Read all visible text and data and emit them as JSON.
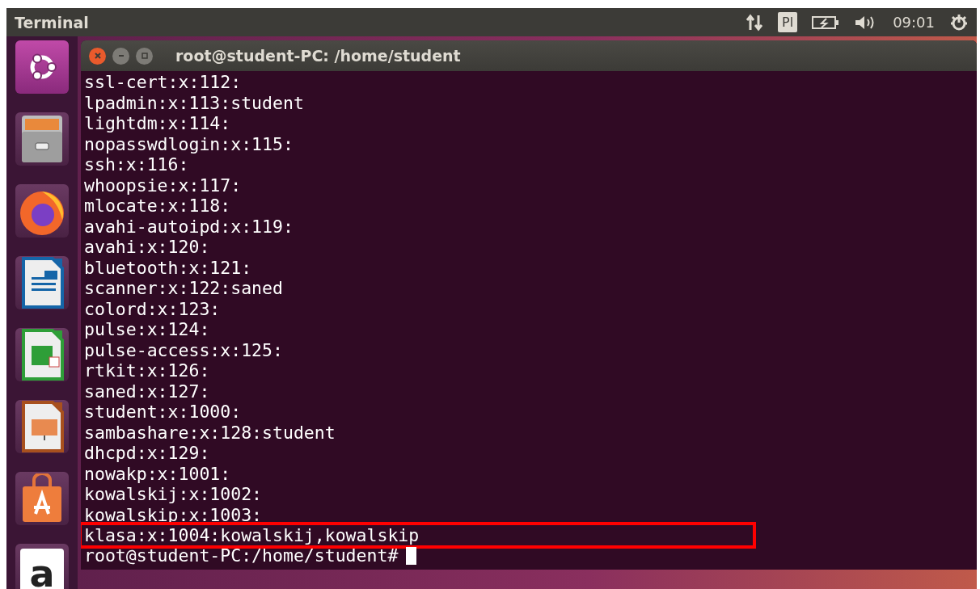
{
  "top_panel": {
    "title": "Terminal",
    "keyboard_layout": "Pl",
    "clock": "09:01"
  },
  "launcher": {
    "items": [
      {
        "kind": "dash",
        "selected": true
      },
      {
        "kind": "files",
        "selected": false
      },
      {
        "kind": "browser",
        "selected": false
      },
      {
        "kind": "writer",
        "selected": false
      },
      {
        "kind": "calc",
        "selected": false
      },
      {
        "kind": "impress",
        "selected": false
      },
      {
        "kind": "software",
        "selected": false
      },
      {
        "kind": "amazon",
        "label": "a",
        "selected": false
      }
    ]
  },
  "window": {
    "title": "root@student-PC: /home/student",
    "lines": [
      {
        "text": "ssl-cert:x:112:",
        "highlighted": false
      },
      {
        "text": "lpadmin:x:113:student",
        "highlighted": false
      },
      {
        "text": "lightdm:x:114:",
        "highlighted": false
      },
      {
        "text": "nopasswdlogin:x:115:",
        "highlighted": false
      },
      {
        "text": "ssh:x:116:",
        "highlighted": false
      },
      {
        "text": "whoopsie:x:117:",
        "highlighted": false
      },
      {
        "text": "mlocate:x:118:",
        "highlighted": false
      },
      {
        "text": "avahi-autoipd:x:119:",
        "highlighted": false
      },
      {
        "text": "avahi:x:120:",
        "highlighted": false
      },
      {
        "text": "bluetooth:x:121:",
        "highlighted": false
      },
      {
        "text": "scanner:x:122:saned",
        "highlighted": false
      },
      {
        "text": "colord:x:123:",
        "highlighted": false
      },
      {
        "text": "pulse:x:124:",
        "highlighted": false
      },
      {
        "text": "pulse-access:x:125:",
        "highlighted": false
      },
      {
        "text": "rtkit:x:126:",
        "highlighted": false
      },
      {
        "text": "saned:x:127:",
        "highlighted": false
      },
      {
        "text": "student:x:1000:",
        "highlighted": false
      },
      {
        "text": "sambashare:x:128:student",
        "highlighted": false
      },
      {
        "text": "dhcpd:x:129:",
        "highlighted": false
      },
      {
        "text": "nowakp:x:1001:",
        "highlighted": false
      },
      {
        "text": "kowalskij:x:1002:",
        "highlighted": false
      },
      {
        "text": "kowalskip:x:1003:",
        "highlighted": false
      },
      {
        "text": "klasa:x:1004:kowalskij,kowalskip",
        "highlighted": true
      }
    ],
    "prompt": "root@student-PC:/home/student#"
  }
}
